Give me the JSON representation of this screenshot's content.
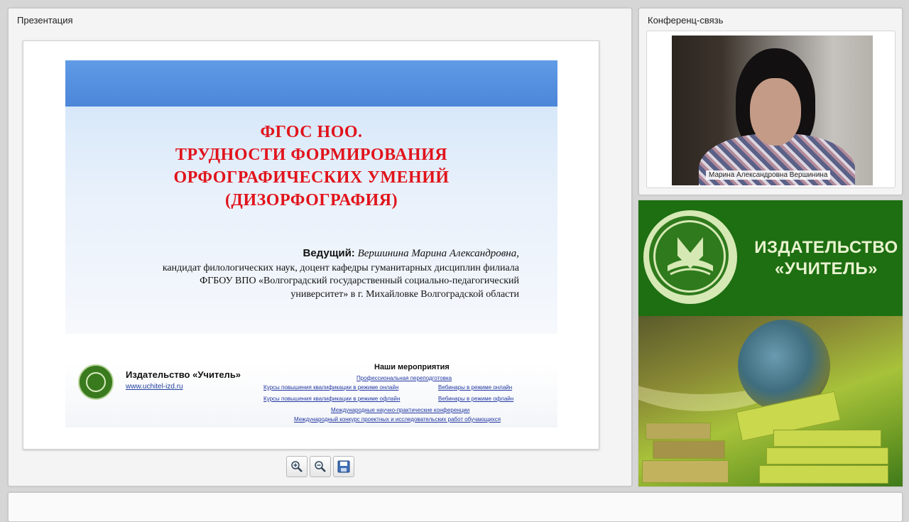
{
  "presentation_panel": {
    "title": "Презентация"
  },
  "slide": {
    "title_lines": [
      "ФГОС НОО.",
      "ТРУДНОСТИ ФОРМИРОВАНИЯ",
      "ОРФОГРАФИЧЕСКИХ УМЕНИЙ",
      "(ДИЗОРФОГРАФИЯ)"
    ],
    "presenter_label": "Ведущий:",
    "presenter_name": "Вершинина Марина Александровна,",
    "presenter_desc": [
      "кандидат филологических наук, доцент кафедры гуманитарных дисциплин филиала",
      "ФГБОУ ВПО «Волгоградский государственный социально-педагогический",
      "университет» в г. Михайловке Волгоградской области"
    ],
    "publisher": "Издательство «Учитель»",
    "publisher_url": "www.uchitel-izd.ru",
    "events_title": "Наши мероприятия",
    "events": {
      "e1": "Профессиональная переподготовка",
      "e2": "Курсы повышения квалификации в режиме онлайн",
      "e3": "Вебинары в режиме онлайн",
      "e4": "Курсы повышения квалификации в режиме офлайн",
      "e5": "Вебинары в режиме офлайн",
      "e6": "Международные научно-практические конференции",
      "e7": "Международный конкурс проектных и исследовательских работ обучающихся"
    }
  },
  "toolbar": {
    "zoom_in_icon": "zoom-in-icon",
    "zoom_out_icon": "zoom-out-icon",
    "save_icon": "save-icon"
  },
  "conference_panel": {
    "title": "Конференц-связь",
    "participant_name": "Марина Александровна Вершинина"
  },
  "promo": {
    "line1": "ИЗДАТЕЛЬСТВО",
    "line2": "«УЧИТЕЛЬ»"
  }
}
